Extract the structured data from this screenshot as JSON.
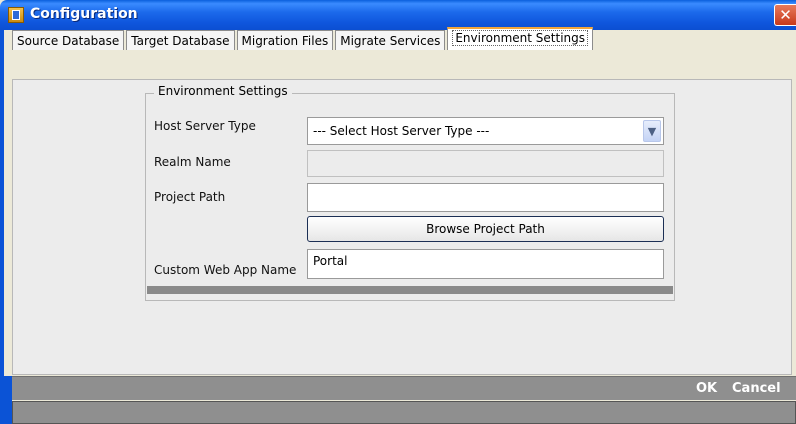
{
  "window": {
    "title": "Configuration",
    "close_glyph": "✕"
  },
  "tabs": [
    {
      "label": "Source Database"
    },
    {
      "label": "Target Database"
    },
    {
      "label": "Migration Files"
    },
    {
      "label": "Migrate Services"
    },
    {
      "label": "Environment Settings",
      "active": true
    }
  ],
  "group": {
    "legend": "Environment Settings"
  },
  "form": {
    "host_server_type_label": "Host Server Type",
    "host_server_type_value": "--- Select Host Server Type ---",
    "realm_name_label": "Realm Name",
    "realm_name_value": "",
    "project_path_label": "Project Path",
    "project_path_value": "",
    "browse_label": "Browse Project Path",
    "custom_web_app_label": "Custom Web App Name",
    "custom_web_app_value": "Portal"
  },
  "footer": {
    "ok_label": "OK",
    "cancel_label": "Cancel"
  },
  "icons": {
    "app": "app-icon",
    "close": "close-icon",
    "dropdown": "chevron-down-icon"
  }
}
